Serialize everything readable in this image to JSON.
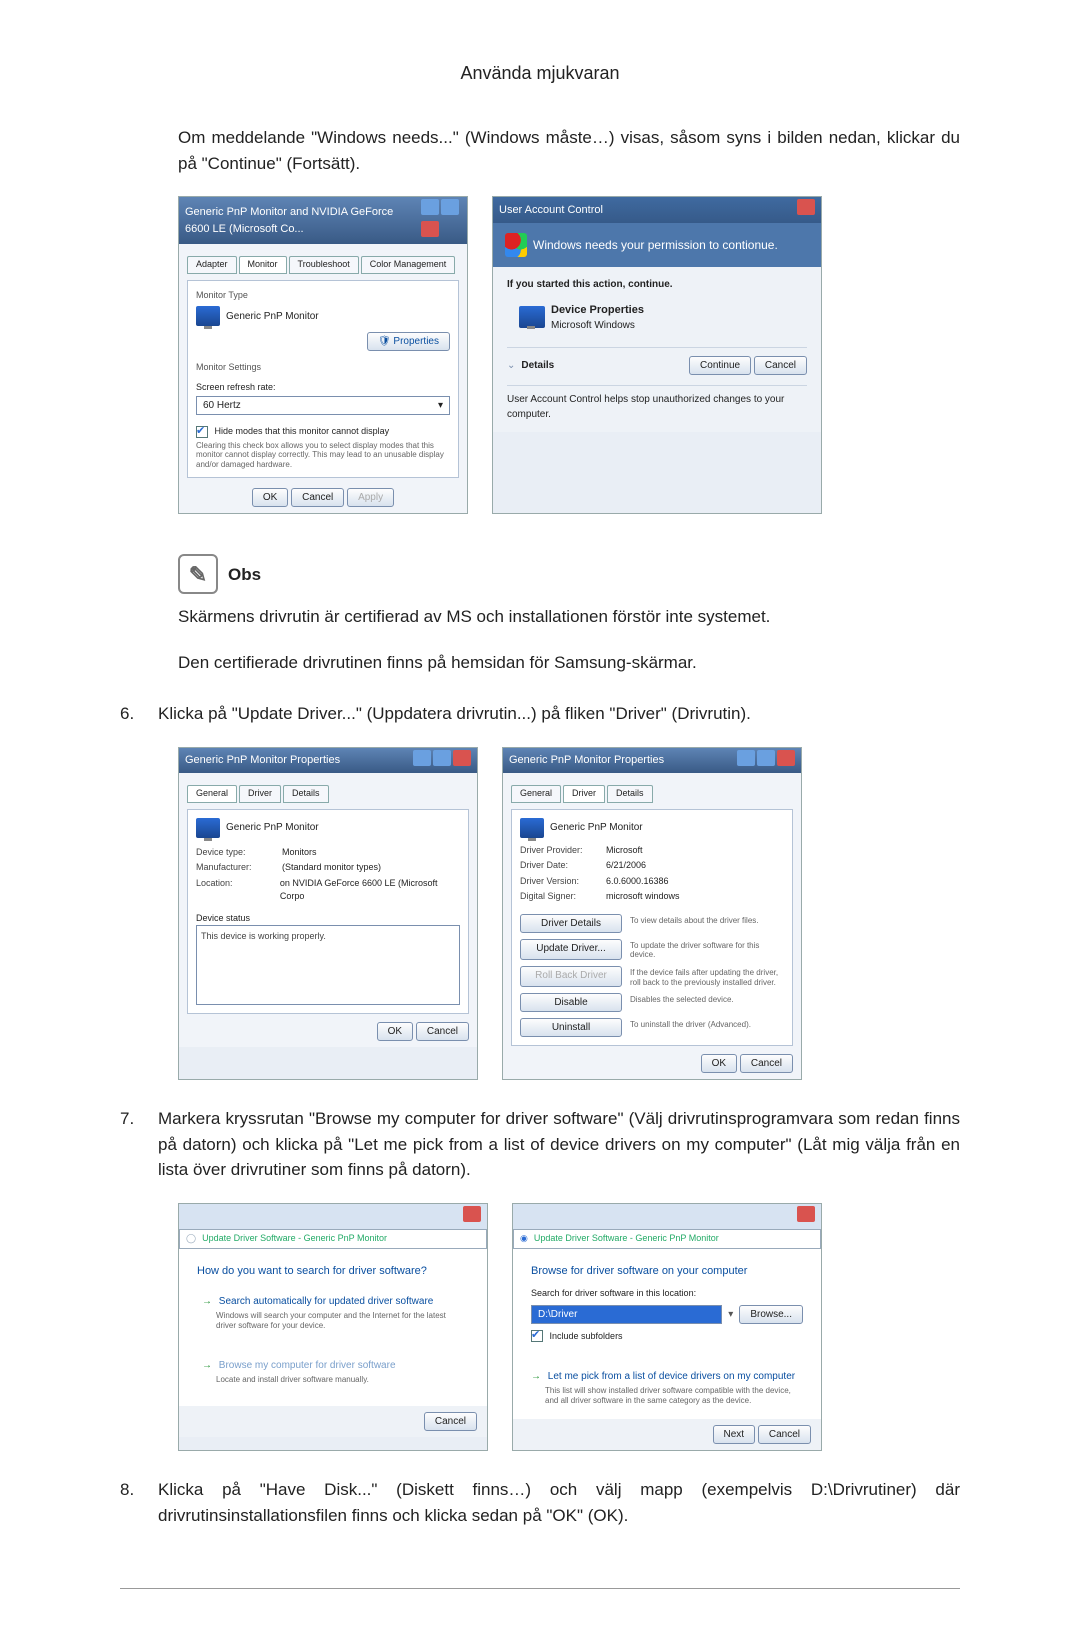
{
  "header": "Använda mjukvaran",
  "intro": "Om meddelande \"Windows needs...\" (Windows måste…) visas, såsom syns i bilden nedan, klickar du på \"Continue\" (Fortsätt).",
  "obs_label": "Obs",
  "obs_p1": "Skärmens drivrutin är certifierad av MS och installationen förstör inte systemet.",
  "obs_p2": "Den certifierade drivrutinen finns på hemsidan för Samsung-skärmar.",
  "step6_n": "6.",
  "step6": "Klicka på \"Update Driver...\" (Uppdatera drivrutin...) på fliken \"Driver\" (Drivrutin).",
  "step7_n": "7.",
  "step7": "Markera kryssrutan \"Browse my computer for driver software\" (Välj drivrutinsprogramvara som redan finns på datorn) och klicka på \"Let me pick from a list of device drivers on my computer\" (Låt mig välja från en lista över drivrutiner som finns på datorn).",
  "step8_n": "8.",
  "step8": "Klicka på \"Have Disk...\" (Diskett finns…) och välj mapp (exempelvis D:\\Drivrutiner) där drivrutinsinstallationsfilen finns och klicka sedan på \"OK\" (OK).",
  "scrA": {
    "title": "Generic PnP Monitor and NVIDIA GeForce 6600 LE (Microsoft Co...",
    "tabs": [
      "Adapter",
      "Monitor",
      "Troubleshoot",
      "Color Management"
    ],
    "monitor_type_label": "Monitor Type",
    "monitor_name": "Generic PnP Monitor",
    "properties_btn": "Properties",
    "monitor_settings_label": "Monitor Settings",
    "refresh_label": "Screen refresh rate:",
    "refresh_value": "60 Hertz",
    "hide_modes": "Hide modes that this monitor cannot display",
    "hide_modes_note": "Clearing this check box allows you to select display modes that this monitor cannot display correctly. This may lead to an unusable display and/or damaged hardware.",
    "ok": "OK",
    "cancel": "Cancel",
    "apply": "Apply"
  },
  "scrB": {
    "title": "User Account Control",
    "headline": "Windows needs your permission to contionue.",
    "started": "If you started this action, continue.",
    "item_title": "Device Properties",
    "item_pub": "Microsoft Windows",
    "details": "Details",
    "continue": "Continue",
    "cancel": "Cancel",
    "footer": "User Account Control helps stop unauthorized changes to your computer."
  },
  "scrC": {
    "title": "Generic PnP Monitor Properties",
    "tabs": [
      "General",
      "Driver",
      "Details"
    ],
    "name": "Generic PnP Monitor",
    "k_devtype": "Device type:",
    "v_devtype": "Monitors",
    "k_manu": "Manufacturer:",
    "v_manu": "(Standard monitor types)",
    "k_loc": "Location:",
    "v_loc": "on NVIDIA GeForce 6600 LE (Microsoft Corpo",
    "devstatus_label": "Device status",
    "devstatus_text": "This device is working properly.",
    "ok": "OK",
    "cancel": "Cancel"
  },
  "scrD": {
    "title": "Generic PnP Monitor Properties",
    "tabs": [
      "General",
      "Driver",
      "Details"
    ],
    "name": "Generic PnP Monitor",
    "k_prov": "Driver Provider:",
    "v_prov": "Microsoft",
    "k_date": "Driver Date:",
    "v_date": "6/21/2006",
    "k_ver": "Driver Version:",
    "v_ver": "6.0.6000.16386",
    "k_sign": "Digital Signer:",
    "v_sign": "microsoft windows",
    "btn_details": "Driver Details",
    "desc_details": "To view details about the driver files.",
    "btn_update": "Update Driver...",
    "desc_update": "To update the driver software for this device.",
    "btn_rollback": "Roll Back Driver",
    "desc_rollback": "If the device fails after updating the driver, roll back to the previously installed driver.",
    "btn_disable": "Disable",
    "desc_disable": "Disables the selected device.",
    "btn_uninst": "Uninstall",
    "desc_uninst": "To uninstall the driver (Advanced).",
    "ok": "OK",
    "cancel": "Cancel"
  },
  "scrE": {
    "crumb": "Update Driver Software - Generic PnP Monitor",
    "heading": "How do you want to search for driver software?",
    "opt1_title": "Search automatically for updated driver software",
    "opt1_note": "Windows will search your computer and the Internet for the latest driver software for your device.",
    "opt2_title": "Browse my computer for driver software",
    "opt2_note": "Locate and install driver software manually.",
    "cancel": "Cancel"
  },
  "scrF": {
    "crumb": "Update Driver Software - Generic PnP Monitor",
    "heading": "Browse for driver software on your computer",
    "search_label": "Search for driver software in this location:",
    "path": "D:\\Driver",
    "browse": "Browse...",
    "include_sub": "Include subfolders",
    "opt_title": "Let me pick from a list of device drivers on my computer",
    "opt_note": "This list will show installed driver software compatible with the device, and all driver software in the same category as the device.",
    "next": "Next",
    "cancel": "Cancel"
  }
}
